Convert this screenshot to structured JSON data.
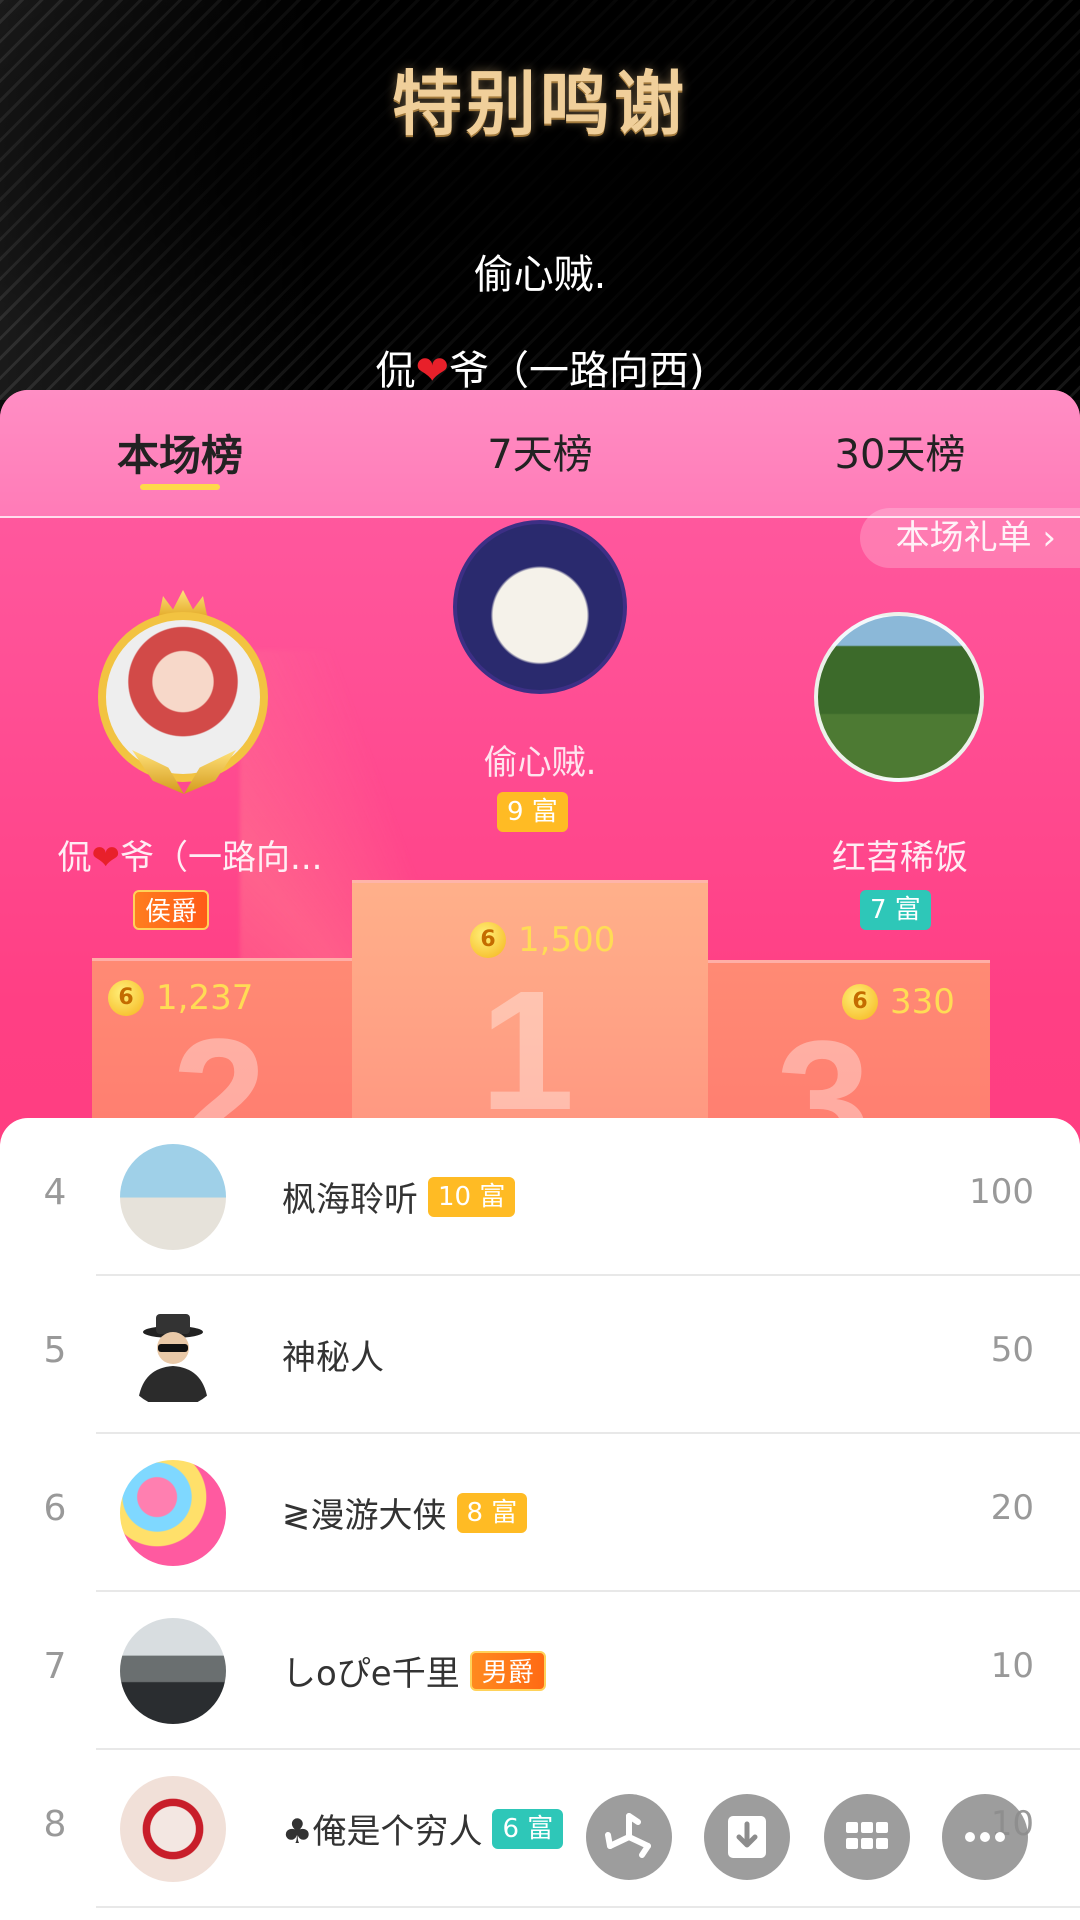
{
  "banner": {
    "title": "特别鸣谢",
    "line1": "偷心贼.",
    "line2_prefix": "侃",
    "line2_heart": "❤",
    "line2_suffix": "爷（一路向西)"
  },
  "tabs": [
    {
      "label": "本场榜",
      "active": true
    },
    {
      "label": "7天榜",
      "active": false
    },
    {
      "label": "30天榜",
      "active": false
    }
  ],
  "gift_list_link": "本场礼单 ›",
  "podium": {
    "first": {
      "rank": "1",
      "name": "偷心贼.",
      "badge": "9 富",
      "amount": "1,500"
    },
    "second": {
      "rank": "2",
      "name_prefix": "侃",
      "name_heart": "❤",
      "name_suffix": "爷（一路向...",
      "badge": "侯爵",
      "amount": "1,237"
    },
    "third": {
      "rank": "3",
      "name": "红苕稀饭",
      "badge": "7 富",
      "amount": "330"
    }
  },
  "list": [
    {
      "rank": "4",
      "name": "枫海聆听",
      "badge": "10 富",
      "amount": "100"
    },
    {
      "rank": "5",
      "name": "神秘人",
      "badge": "",
      "amount": "50"
    },
    {
      "rank": "6",
      "name": "≷漫游大侠",
      "badge": "8 富",
      "amount": "20"
    },
    {
      "rank": "7",
      "name": "しoぴe千里",
      "badge": "男爵",
      "amount": "10"
    },
    {
      "rank": "8",
      "name": "♣俺是个穷人",
      "badge": "6 富",
      "amount": "10"
    }
  ],
  "coin_glyph": "6",
  "colors": {
    "accent": "#ff3f84",
    "gold": "#ffbb24",
    "teal": "#2ec7b8"
  }
}
